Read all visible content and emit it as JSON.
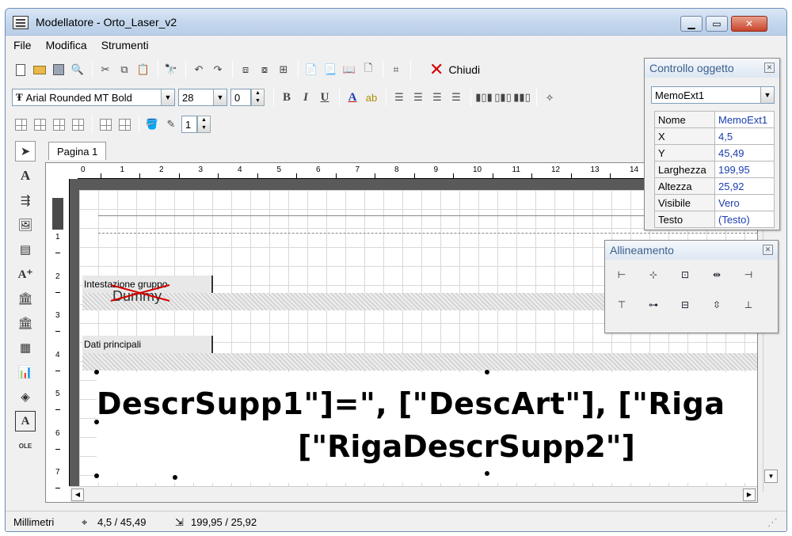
{
  "window": {
    "title": "Modellatore - Orto_Laser_v2"
  },
  "menu": [
    {
      "label": "File"
    },
    {
      "label": "Modifica"
    },
    {
      "label": "Strumenti"
    }
  ],
  "toolbar": {
    "chiudi_label": "Chiudi"
  },
  "format": {
    "font_name": "Arial Rounded MT Bold",
    "font_size": "28",
    "rotation": "0",
    "bold": "B",
    "italic": "I",
    "underline": "U",
    "color_letter": "A"
  },
  "frame": {
    "width": "1"
  },
  "left_tools": {
    "text_tool": "A",
    "frame_tool": "A",
    "ole_tool": "OLE"
  },
  "tab": {
    "label": "Pagina 1"
  },
  "ruler": {
    "h": [
      "0",
      "1",
      "2",
      "3",
      "4",
      "5",
      "6",
      "7",
      "8",
      "9",
      "10",
      "11",
      "12",
      "13",
      "14"
    ],
    "v": [
      "1",
      "2",
      "3",
      "4",
      "5",
      "6",
      "7"
    ]
  },
  "bands": {
    "group_header": "Intestazione gruppo",
    "dummy": "Dummy",
    "main_data": "Dati principali"
  },
  "memo": {
    "line1": "DescrSupp1\"]=\", [\"DescArt\"], [\"Riga",
    "line2": "[\"RigaDescrSupp2\"]"
  },
  "object_panel": {
    "title": "Controllo oggetto",
    "selected": "MemoExt1",
    "properties": [
      {
        "key": "Nome",
        "value": "MemoExt1"
      },
      {
        "key": "X",
        "value": "4,5"
      },
      {
        "key": "Y",
        "value": "45,49"
      },
      {
        "key": "Larghezza",
        "value": "199,95"
      },
      {
        "key": "Altezza",
        "value": "25,92"
      },
      {
        "key": "Visibile",
        "value": "Vero"
      },
      {
        "key": "Testo",
        "value": "(Testo)"
      }
    ]
  },
  "align_panel": {
    "title": "Allineamento"
  },
  "status": {
    "units": "Millimetri",
    "position": "4,5 / 45,49",
    "size": "199,95 / 25,92"
  }
}
